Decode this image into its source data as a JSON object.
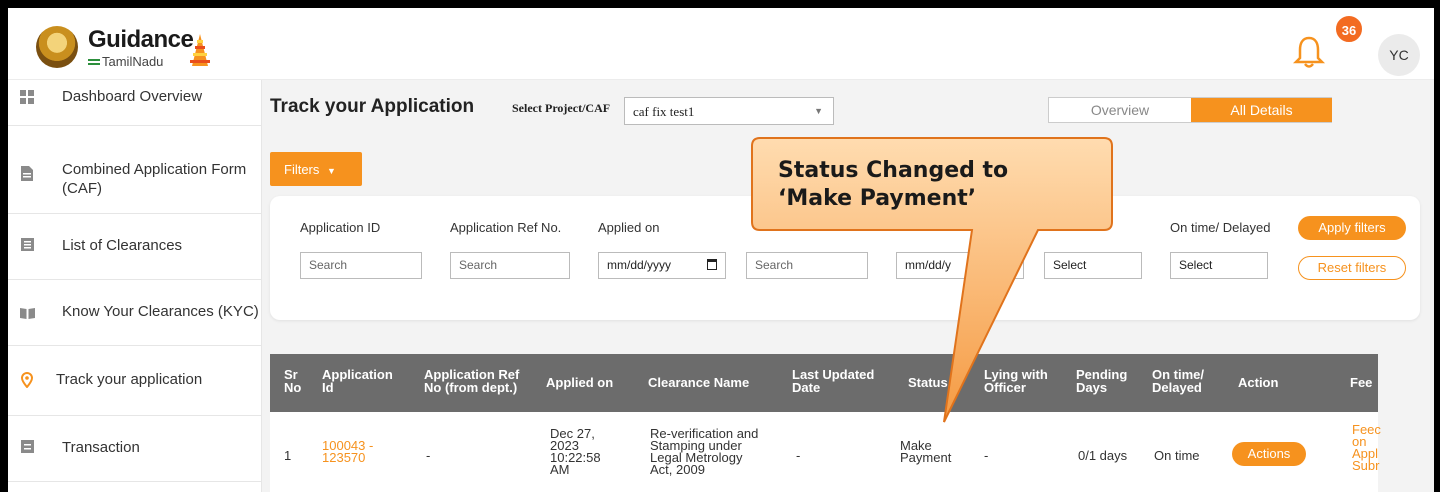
{
  "header": {
    "logo_title": "Guidance",
    "logo_subtitle": "TamilNadu",
    "notification_count": "36",
    "user_initials": "YC"
  },
  "sidebar": {
    "items": [
      {
        "label": "Dashboard Overview",
        "icon": "grid-icon"
      },
      {
        "label": "Combined Application Form (CAF)",
        "icon": "document-icon"
      },
      {
        "label": "List of Clearances",
        "icon": "list-icon"
      },
      {
        "label": "Know Your Clearances (KYC)",
        "icon": "book-icon"
      },
      {
        "label": "Track your application",
        "icon": "location-pin-icon"
      },
      {
        "label": "Transaction",
        "icon": "transaction-icon"
      }
    ]
  },
  "main": {
    "title": "Track your Application",
    "select_label": "Select Project/CAF",
    "select_value": "caf fix test1",
    "toggle": {
      "overview": "Overview",
      "all_details": "All Details"
    },
    "filters_label": "Filters"
  },
  "filters": {
    "application_id_label": "Application ID",
    "application_id_placeholder": "Search",
    "ref_no_label": "Application Ref No.",
    "ref_no_placeholder": "Search",
    "applied_on_label": "Applied on",
    "applied_on_placeholder": "mm/dd/yyyy",
    "clearance_placeholder": "Search",
    "last_updated_placeholder": "mm/dd/y",
    "status_placeholder": "Select",
    "ontime_label": "On time/ Delayed",
    "ontime_placeholder": "Select",
    "apply_label": "Apply filters",
    "reset_label": "Reset filters"
  },
  "table": {
    "headers": {
      "sr_1": "Sr",
      "sr_2": "No",
      "app_id_1": "Application",
      "app_id_2": "Id",
      "ref_1": "Application Ref",
      "ref_2": "No (from dept.)",
      "applied": "Applied on",
      "clearance": "Clearance Name",
      "updated_1": "Last Updated",
      "updated_2": "Date",
      "status": "Status",
      "lying_1": "Lying with",
      "lying_2": "Officer",
      "pending_1": "Pending",
      "pending_2": "Days",
      "ontime_1": "On time/",
      "ontime_2": "Delayed",
      "action": "Action",
      "feedback": "Fee"
    },
    "row": {
      "sr": "1",
      "app_id_1": "100043 -",
      "app_id_2": "123570",
      "ref": "-",
      "applied_1": "Dec 27,",
      "applied_2": "2023",
      "applied_3": "10:22:58",
      "applied_4": "AM",
      "clearance_1": "Re-verification and",
      "clearance_2": "Stamping under",
      "clearance_3": "Legal Metrology",
      "clearance_4": "Act, 2009",
      "updated": "-",
      "status_1": "Make",
      "status_2": "Payment",
      "lying": "-",
      "pending": "0/1 days",
      "ontime": "On time",
      "action_label": "Actions",
      "feedback_1": "Feec",
      "feedback_2": "on",
      "feedback_3": "Appl",
      "feedback_4": "Subr"
    }
  },
  "callout": {
    "line1": "Status Changed to",
    "line2": "‘Make Payment’"
  },
  "colors": {
    "accent": "#f6921e",
    "badge": "#f36b21",
    "table_header": "#6c6c6c"
  }
}
